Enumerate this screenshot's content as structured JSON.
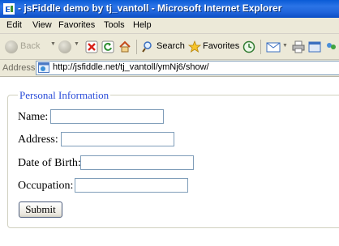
{
  "window": {
    "title": "- jsFiddle demo by tj_vantoll - Microsoft Internet Explorer",
    "icon": "ie-icon"
  },
  "menu": [
    "Edit",
    "View",
    "Favorites",
    "Tools",
    "Help"
  ],
  "toolbar": {
    "back_label": "Back",
    "search_label": "Search",
    "favorites_label": "Favorites"
  },
  "address": {
    "label": "Address",
    "url": "http://jsfiddle.net/tj_vantoll/ymNj6/show/"
  },
  "form": {
    "legend": "Personal Information",
    "fields": [
      {
        "label": "Name:",
        "value": ""
      },
      {
        "label": "Address:",
        "value": ""
      },
      {
        "label": "Date of Birth:",
        "value": ""
      },
      {
        "label": "Occupation:",
        "value": ""
      }
    ],
    "submit_label": "Submit"
  },
  "colors": {
    "titlebar": "#0a5bd6",
    "legend": "#2a4cd8",
    "chrome": "#ece9d8"
  }
}
